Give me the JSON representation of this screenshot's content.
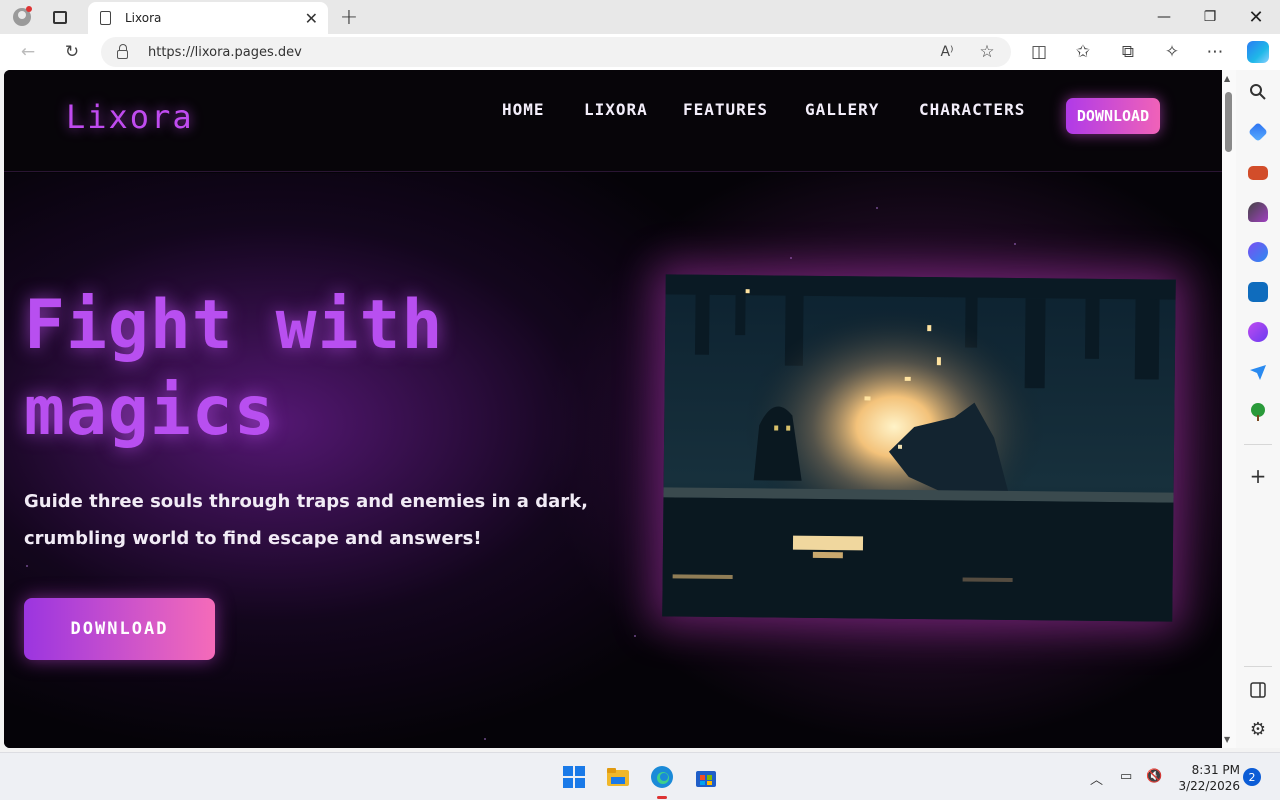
{
  "browser": {
    "tab_title": "Lixora",
    "url": "https://lixora.pages.dev"
  },
  "site": {
    "logo": "Lixora",
    "nav": [
      "HOME",
      "LIXORA",
      "FEATURES",
      "GALLERY",
      "CHARACTERS"
    ],
    "nav_download": "DOWNLOAD",
    "hero": {
      "title_line1": "Fight with",
      "title_line2": "magics",
      "subtitle_line1": "Guide three souls through traps and enemies in a dark,",
      "subtitle_line2": "crumbling world to find escape and answers!",
      "download_label": "DOWNLOAD"
    }
  },
  "taskbar": {
    "time": "8:31 PM",
    "date": "3/22/2026",
    "notifications": "2"
  },
  "colors": {
    "accent_purple": "#b84ff0",
    "accent_pink": "#f56bb9",
    "page_bg": "#050308"
  }
}
